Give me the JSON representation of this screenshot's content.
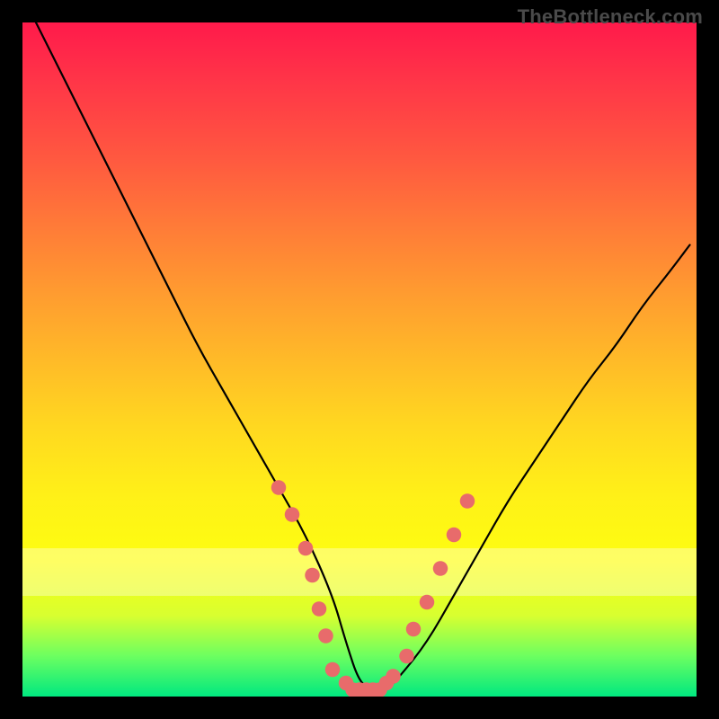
{
  "watermark": "TheBottleneck.com",
  "colors": {
    "border": "#000000",
    "curve_stroke": "#000000",
    "marker_fill": "#e86b6b",
    "gradient_top": "#ff1a4b",
    "gradient_bottom": "#00e880"
  },
  "chart_data": {
    "type": "line",
    "title": "",
    "xlabel": "",
    "ylabel": "",
    "xlim": [
      0,
      100
    ],
    "ylim": [
      0,
      100
    ],
    "annotations": [
      "TheBottleneck.com"
    ],
    "series": [
      {
        "name": "bottleneck-curve",
        "x": [
          2,
          6,
          10,
          14,
          18,
          22,
          26,
          30,
          34,
          38,
          42,
          46,
          48,
          50,
          52,
          54,
          56,
          60,
          64,
          68,
          72,
          76,
          80,
          84,
          88,
          92,
          96,
          99
        ],
        "values": [
          100,
          92,
          84,
          76,
          68,
          60,
          52,
          45,
          38,
          31,
          24,
          15,
          8,
          2,
          1,
          1,
          3,
          8,
          15,
          22,
          29,
          35,
          41,
          47,
          52,
          58,
          63,
          67
        ]
      },
      {
        "name": "markers-left",
        "x": [
          38,
          40,
          42,
          43,
          44,
          45
        ],
        "values": [
          31,
          27,
          22,
          18,
          13,
          9
        ]
      },
      {
        "name": "markers-bottom",
        "x": [
          46,
          48,
          49,
          50,
          51,
          52,
          53,
          54,
          55
        ],
        "values": [
          4,
          2,
          1,
          1,
          1,
          1,
          1,
          2,
          3
        ]
      },
      {
        "name": "markers-right",
        "x": [
          57,
          58,
          60,
          62,
          64,
          66
        ],
        "values": [
          6,
          10,
          14,
          19,
          24,
          29
        ]
      }
    ]
  }
}
